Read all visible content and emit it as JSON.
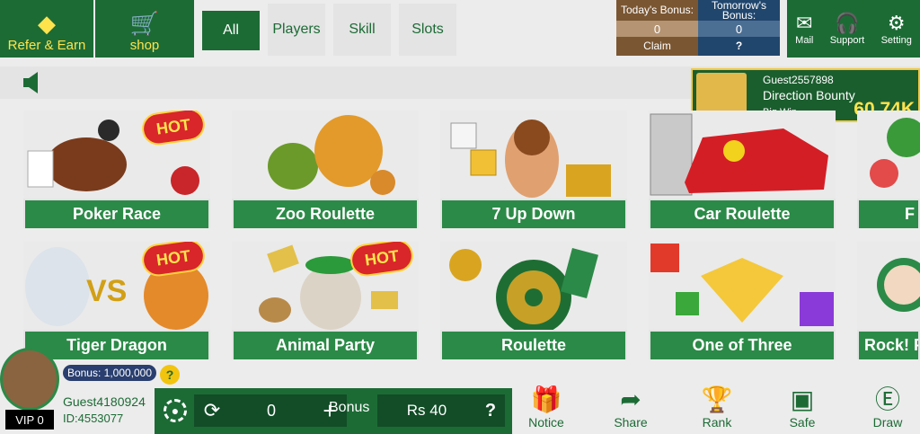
{
  "header": {
    "refer": {
      "label": "Refer & Earn",
      "icon": "diamond-icon"
    },
    "shop": {
      "label": "shop",
      "icon": "cart-icon"
    },
    "tabs": [
      {
        "label": "All",
        "active": true
      },
      {
        "label": "Players",
        "active": false
      },
      {
        "label": "Skill",
        "active": false
      },
      {
        "label": "Slots",
        "active": false
      }
    ],
    "bonus": {
      "today_label": "Today's Bonus:",
      "today_value": "0",
      "tomorrow_label": "Tomorrow's Bonus:",
      "tomorrow_value": "0",
      "claim_label": "Claim",
      "tomorrow_hint": "?"
    },
    "utilities": [
      {
        "label": "Mail",
        "icon": "mail-icon"
      },
      {
        "label": "Support",
        "icon": "headset-icon"
      },
      {
        "label": "Setting",
        "icon": "gear-icon"
      }
    ]
  },
  "big_win": {
    "user": "Guest2557898",
    "game": "Direction Bounty",
    "label": "Big Win",
    "amount": "60.74K"
  },
  "games": [
    {
      "label": "Poker Race",
      "hot": true
    },
    {
      "label": "Zoo Roulette",
      "hot": false
    },
    {
      "label": "7 Up Down",
      "hot": false
    },
    {
      "label": "Car Roulette",
      "hot": false
    },
    {
      "label": "F",
      "hot": false
    },
    {
      "label": "Tiger Dragon",
      "hot": true
    },
    {
      "label": "Animal Party",
      "hot": true
    },
    {
      "label": "Roulette",
      "hot": false
    },
    {
      "label": "One of Three",
      "hot": false
    },
    {
      "label": "Rock! P",
      "hot": false
    }
  ],
  "hot_badge": "HOT",
  "user": {
    "vip": "VIP 0",
    "bonus": "Bonus: 1,000,000",
    "help": "?",
    "name": "Guest4180924",
    "id": "ID:4553077"
  },
  "wallet": {
    "balance": "0",
    "plus": "+",
    "bonus_label": "Bonus",
    "bonus_value": "Rs 40",
    "help": "?"
  },
  "nav": [
    {
      "label": "Notice",
      "icon": "gift-icon"
    },
    {
      "label": "Share",
      "icon": "share-arrow-icon"
    },
    {
      "label": "Rank",
      "icon": "trophy-icon"
    },
    {
      "label": "Safe",
      "icon": "safe-icon"
    },
    {
      "label": "Draw",
      "icon": "dollar-coin-icon"
    }
  ]
}
